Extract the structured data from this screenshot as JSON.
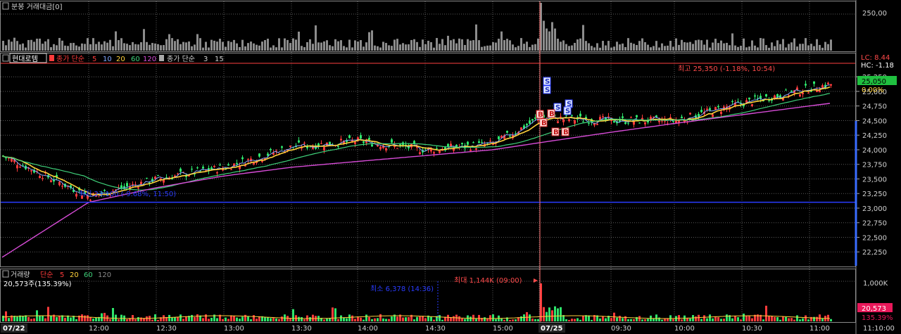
{
  "colors": {
    "background": "#000000",
    "up": "#ff3b3b",
    "down": "#2ee56b",
    "ma5": "#7fa6ff",
    "ma20": "#ffd23c",
    "ma60": "#3fd17a",
    "ma120": "#d64bd6",
    "grid": "#5a5a5a",
    "hline": "#2a3cff",
    "cursor": "#ff6a6a",
    "current_price_box": "#20c040",
    "volume_box": "#e8185a",
    "axis_blue": "#3a6cff"
  },
  "panels": {
    "amount": {
      "title": "분봉 거래대금[0]",
      "ticks": [
        "250,00"
      ]
    },
    "price": {
      "stock_name": "현대로템",
      "legend1_prefix": "종가 단순",
      "legend1": [
        "5",
        "10",
        "20",
        "60",
        "120"
      ],
      "legend2_prefix": "종가 단순",
      "legend2": [
        "3",
        "15"
      ],
      "high_label": "최고 25,350 (-1.18%, 10:54)",
      "low_label": "최저 23,100 (-9.68%, 11:50)",
      "lc_label": "LC: 8.44",
      "hc_label": "HC: -1.18",
      "current_price": "25,050",
      "current_pct": "0.00%",
      "signals": [
        "S",
        "S",
        "S",
        "S",
        "S",
        "B",
        "B",
        "B",
        "B",
        "B"
      ]
    },
    "volume": {
      "title": "거래량",
      "legend_prefix": "단순",
      "legend": [
        "5",
        "20",
        "60",
        "120"
      ],
      "current_info": "20,573주(135.39%)",
      "max_label": "최대 1,144K (09:00)",
      "min_label": "최소 6,378 (14:36)",
      "axis_label": "1,000K",
      "current_box": "20,573",
      "current_box_sub": "135.39%"
    }
  },
  "time_axis": {
    "labels": [
      "07/22",
      "12:00",
      "12:30",
      "13:00",
      "13:30",
      "14:00",
      "14:30",
      "15:00",
      "07/25",
      "09:30",
      "10:00",
      "10:30",
      "11:00"
    ],
    "right_label": "11:10:00"
  },
  "chart_data": {
    "type": "line",
    "x_label_sequence": [
      "07/22",
      "12:00",
      "12:30",
      "13:00",
      "13:30",
      "14:00",
      "14:30",
      "15:00",
      "07/25",
      "09:30",
      "10:00",
      "10:30",
      "11:00"
    ],
    "ylim": [
      22000,
      25650
    ],
    "y_ticks": [
      22250,
      22500,
      22750,
      23000,
      23250,
      23500,
      23750,
      24000,
      24250,
      24500,
      24750,
      25000,
      25250
    ],
    "y_tick_labels": [
      "22,250",
      "22,500",
      "22,750",
      "23,000",
      "23,250",
      "23,500",
      "23,750",
      "24,000",
      "24,250",
      "24,500",
      "24,750",
      "25,000",
      "25,250"
    ],
    "horizontal_line": 23100,
    "series": [
      {
        "name": "종가",
        "x": [
          "07/22",
          "12:00",
          "12:30",
          "13:00",
          "13:30",
          "14:00",
          "14:30",
          "15:00",
          "07/25",
          "09:30",
          "10:00",
          "10:30",
          "11:00"
        ],
        "values": [
          23900,
          23200,
          23500,
          23700,
          24050,
          24150,
          24000,
          24100,
          24550,
          24500,
          24500,
          24800,
          25050
        ]
      },
      {
        "name": "120",
        "x": [
          "07/22",
          "12:00",
          "12:30",
          "13:00",
          "13:30",
          "14:00",
          "14:30",
          "15:00",
          "07/25",
          "09:30",
          "10:00",
          "10:30",
          "11:00"
        ],
        "values": [
          22150,
          23100,
          23350,
          23550,
          23700,
          23800,
          23900,
          24000,
          24120,
          24300,
          24450,
          24600,
          24750
        ]
      }
    ],
    "volume": {
      "ylim": [
        0,
        1200000
      ],
      "y_ticks": [
        1000000
      ],
      "y_tick_labels": [
        "1,000K"
      ],
      "max": 1144000,
      "min": 6378
    }
  }
}
